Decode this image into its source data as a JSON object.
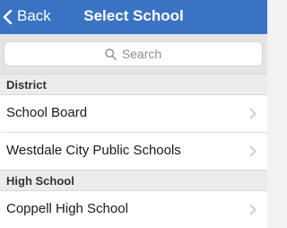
{
  "navbar": {
    "back_label": "Back",
    "title": "Select School",
    "background_color": "#3a73c3"
  },
  "search": {
    "placeholder": "Search",
    "icon": "search-icon"
  },
  "sections": [
    {
      "header": "District",
      "rows": [
        {
          "label": "School Board",
          "icon": "chevron-right-icon"
        },
        {
          "label": "Westdale City Public Schools",
          "icon": "chevron-right-icon"
        }
      ]
    },
    {
      "header": "High School",
      "rows": [
        {
          "label": "Coppell High School",
          "icon": "chevron-right-icon"
        }
      ]
    }
  ]
}
